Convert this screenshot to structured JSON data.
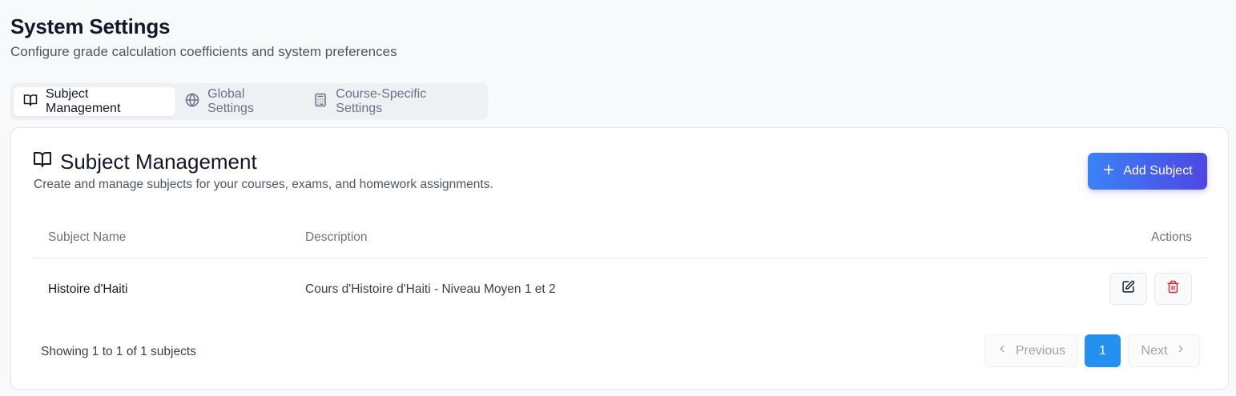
{
  "header": {
    "title": "System Settings",
    "subtitle": "Configure grade calculation coefficients and system preferences"
  },
  "tabs": [
    {
      "label": "Subject Management",
      "icon": "book-open-icon",
      "active": true
    },
    {
      "label": "Global Settings",
      "icon": "globe-icon",
      "active": false
    },
    {
      "label": "Course-Specific Settings",
      "icon": "calculator-icon",
      "active": false
    }
  ],
  "card": {
    "title": "Subject Management",
    "description": "Create and manage subjects for your courses, exams, and homework assignments.",
    "add_button_label": "Add Subject"
  },
  "table": {
    "columns": [
      "Subject Name",
      "Description",
      "Actions"
    ],
    "rows": [
      {
        "name": "Histoire d'Haiti",
        "description": "Cours d'Histoire d'Haiti - Niveau Moyen 1 et 2"
      }
    ]
  },
  "pagination": {
    "summary": "Showing 1 to 1 of 1 subjects",
    "previous_label": "Previous",
    "current_page": "1",
    "next_label": "Next"
  },
  "colors": {
    "accent_gradient_start": "#3b82f6",
    "accent_gradient_end": "#4f46e5",
    "page_active": "#2490f0",
    "delete_red": "#dc2626"
  }
}
